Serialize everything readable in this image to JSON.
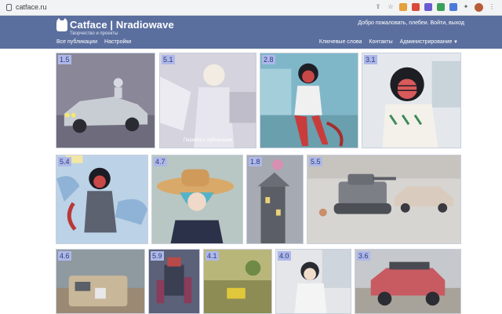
{
  "browser": {
    "url": "catface.ru"
  },
  "site": {
    "title": "Catface | Nradiowave",
    "tagline": "Творчество и проекты",
    "login_text": "Добро пожаловать, плебеи. Войти, выход",
    "nav_left": [
      "Все публикации",
      "Настройки"
    ],
    "nav_right": [
      "Ключевые слова",
      "Контакты",
      "Администрирование"
    ]
  },
  "colors": {
    "header": "#5b6f9f",
    "badge_bg": "#aeb8e8",
    "badge_text": "#2c3a78"
  },
  "gallery": {
    "items": [
      {
        "rating": "1.5",
        "subject": "white car with headlights"
      },
      {
        "rating": "5.1",
        "subject": "winged angel girl",
        "overlay": "Перейти к публикации"
      },
      {
        "rating": "2.8",
        "subject": "red devil girl sitting"
      },
      {
        "rating": "3.1",
        "subject": "devil girl with glasses"
      },
      {
        "rating": "5.4",
        "subject": "devil girl with sharks"
      },
      {
        "rating": "4.7",
        "subject": "girl in straw hat"
      },
      {
        "rating": "1.8",
        "subject": "pink cat on tower"
      },
      {
        "rating": "5.5",
        "subject": "tank and car on road"
      },
      {
        "rating": "4.6",
        "subject": "van in desert"
      },
      {
        "rating": "5.9",
        "subject": "robot mech"
      },
      {
        "rating": "4.1",
        "subject": "yellow scene"
      },
      {
        "rating": "4.0",
        "subject": "girl at desk"
      },
      {
        "rating": "3.6",
        "subject": "red offroad truck"
      }
    ]
  }
}
